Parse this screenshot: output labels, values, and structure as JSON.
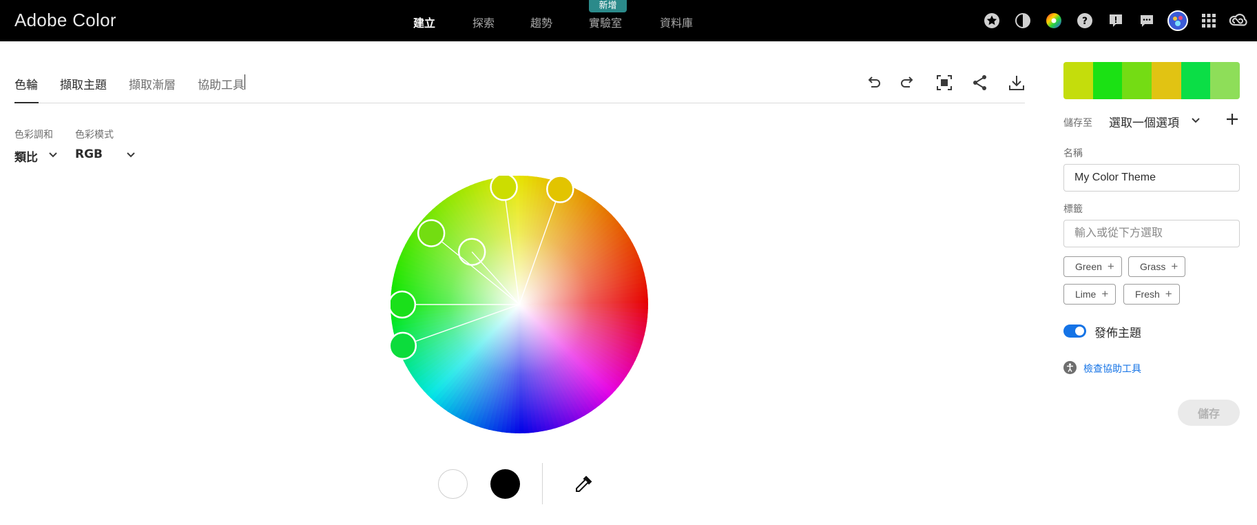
{
  "app": {
    "title": "Adobe Color"
  },
  "topnav": {
    "items": [
      {
        "label": "建立",
        "active": true
      },
      {
        "label": "探索"
      },
      {
        "label": "趨勢"
      },
      {
        "label": "實驗室"
      },
      {
        "label": "資料庫"
      }
    ],
    "new_badge": "新增"
  },
  "top_icons": [
    "star-icon",
    "contrast-icon",
    "color-wheel-app-icon",
    "help-icon",
    "feedback-icon",
    "chat-icon",
    "user-avatar",
    "apps-grid-icon",
    "creative-cloud-icon"
  ],
  "tabs": [
    {
      "label": "色輪",
      "active": true
    },
    {
      "label": "擷取主題"
    },
    {
      "label": "擷取漸層"
    },
    {
      "label": "協助工具"
    }
  ],
  "toolbar": [
    "undo-icon",
    "redo-icon",
    "fullscreen-icon",
    "share-icon",
    "download-icon"
  ],
  "harmony": {
    "label": "色彩調和",
    "value": "類比"
  },
  "mode": {
    "label": "色彩模式",
    "value": "RGB"
  },
  "wheel": {
    "handles": [
      {
        "color": "#E2C400",
        "hue": 47
      },
      {
        "color": "#CCDD00",
        "hue": 65
      },
      {
        "color": "#73DD11",
        "hue": 94
      },
      {
        "color": "#1AE01A",
        "hue": 120
      },
      {
        "color": "#0CDC3C",
        "hue": 133
      }
    ]
  },
  "palette": [
    "#C4DD0C",
    "#1BE114",
    "#74DC14",
    "#E1C313",
    "#0BDE46",
    "#8EDE59"
  ],
  "save_to": {
    "label": "儲存至",
    "value": "選取一個選項"
  },
  "name_field": {
    "label": "名稱",
    "value": "My Color Theme"
  },
  "tags_field": {
    "label": "標籤",
    "placeholder": "輸入或從下方選取"
  },
  "tags": [
    "Green",
    "Grass",
    "Lime",
    "Fresh"
  ],
  "publish": {
    "label": "發佈主題",
    "on": true
  },
  "a11y_link": "檢查協助工具",
  "save_button": "儲存"
}
